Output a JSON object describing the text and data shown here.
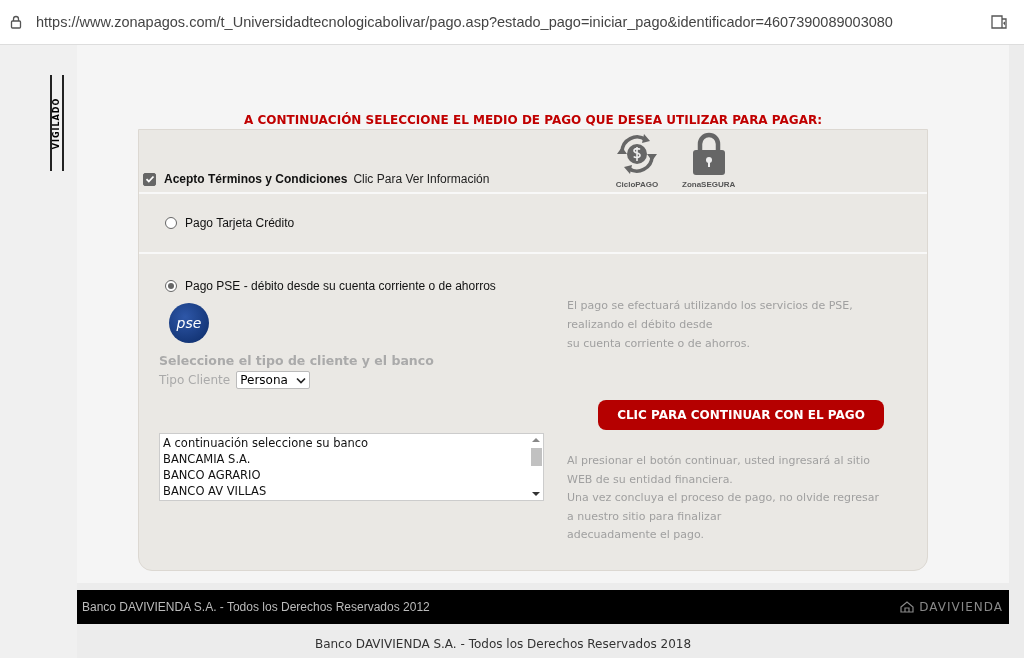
{
  "address_bar": {
    "url": "https://www.zonapagos.com/t_Universidadtecnologicabolivar/pago.asp?estado_pago=iniciar_pago&identificador=4607390089003080"
  },
  "seal": {
    "text": "VIGILADO"
  },
  "heading": "A CONTINUACIÓN SELECCIONE EL MEDIO DE PAGO QUE DESEA UTILIZAR PARA PAGAR:",
  "terms": {
    "checked": true,
    "label": "Acepto Términos y Condiciones",
    "link": "Clic Para Ver Información"
  },
  "badges": [
    {
      "kind": "cycle",
      "label": "CicloPAGO"
    },
    {
      "kind": "lock",
      "label": "ZonaSEGURA"
    }
  ],
  "payment_options": [
    {
      "label": "Pago Tarjeta Crédito",
      "selected": false
    },
    {
      "label": "Pago PSE - débito desde su cuenta corriente o de ahorros",
      "selected": true
    }
  ],
  "pse": {
    "logo_text": "pse",
    "subtitle": "Seleccione el tipo de cliente y el banco",
    "client_type_label": "Tipo Cliente",
    "client_type": "Persona",
    "banks": [
      "A continuación seleccione su banco",
      "BANCAMIA S.A.",
      "BANCO AGRARIO",
      "BANCO AV VILLAS"
    ],
    "info": [
      "El pago se efectuará utilizando los servicios de PSE,",
      "realizando el débito desde",
      "su cuenta corriente o de ahorros."
    ],
    "button": "CLIC PARA CONTINUAR CON EL PAGO",
    "note": [
      "Al presionar el botón continuar, usted ingresará al sitio",
      "WEB de su entidad financiera.",
      "Una vez concluya el proceso de pago, no olvide regresar",
      "a nuestro sitio para finalizar",
      "adecuadamente el pago."
    ]
  },
  "footer_bar": {
    "text": "Banco DAVIVIENDA S.A. - Todos los Derechos Reservados 2012",
    "logo": "DAVIVIENDA"
  },
  "footer": "Banco DAVIVIENDA S.A. - Todos los Derechos Reservados 2018"
}
